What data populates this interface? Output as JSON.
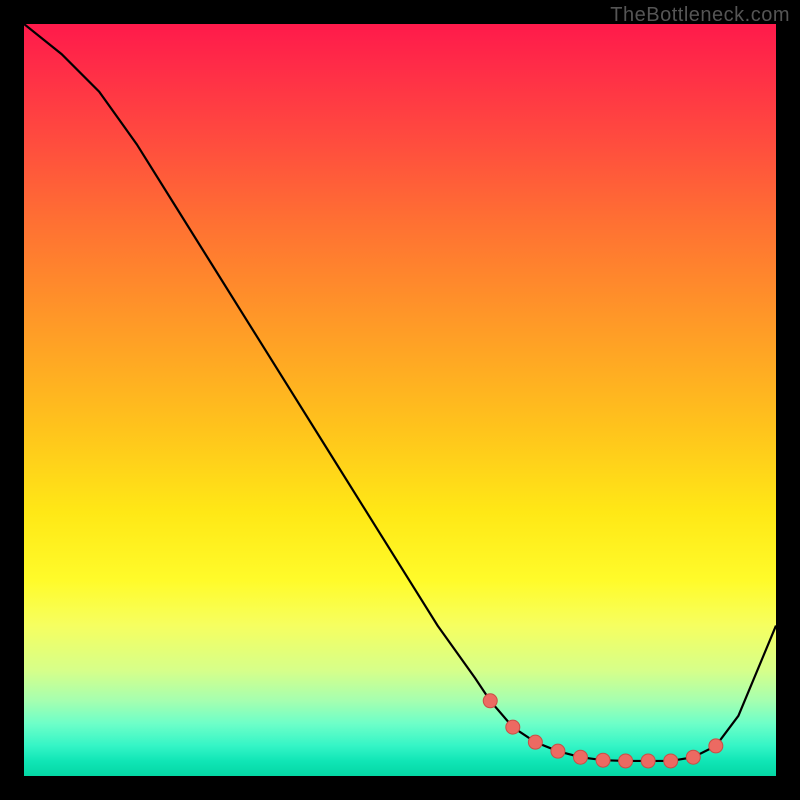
{
  "watermark": "TheBottleneck.com",
  "colors": {
    "background": "#000000",
    "curve_stroke": "#000000",
    "marker_fill": "#ec6a62",
    "marker_stroke": "#c94e46"
  },
  "chart_data": {
    "type": "line",
    "title": "",
    "xlabel": "",
    "ylabel": "",
    "xlim": [
      0,
      100
    ],
    "ylim": [
      0,
      100
    ],
    "grid": false,
    "series": [
      {
        "name": "bottleneck-curve",
        "x": [
          0,
          5,
          10,
          15,
          20,
          25,
          30,
          35,
          40,
          45,
          50,
          55,
          60,
          62,
          65,
          68,
          71,
          74,
          77,
          80,
          83,
          86,
          89,
          92,
          95,
          100
        ],
        "y": [
          100,
          96,
          91,
          84,
          76,
          68,
          60,
          52,
          44,
          36,
          28,
          20,
          13,
          10,
          6.5,
          4.5,
          3.3,
          2.5,
          2.1,
          2.0,
          2.0,
          2.0,
          2.5,
          4,
          8,
          20
        ]
      }
    ],
    "markers": {
      "name": "flat-region-dots",
      "x": [
        62,
        65,
        68,
        71,
        74,
        77,
        80,
        83,
        86,
        89,
        92
      ],
      "y": [
        10,
        6.5,
        4.5,
        3.3,
        2.5,
        2.1,
        2.0,
        2.0,
        2.0,
        2.5,
        4
      ]
    }
  }
}
